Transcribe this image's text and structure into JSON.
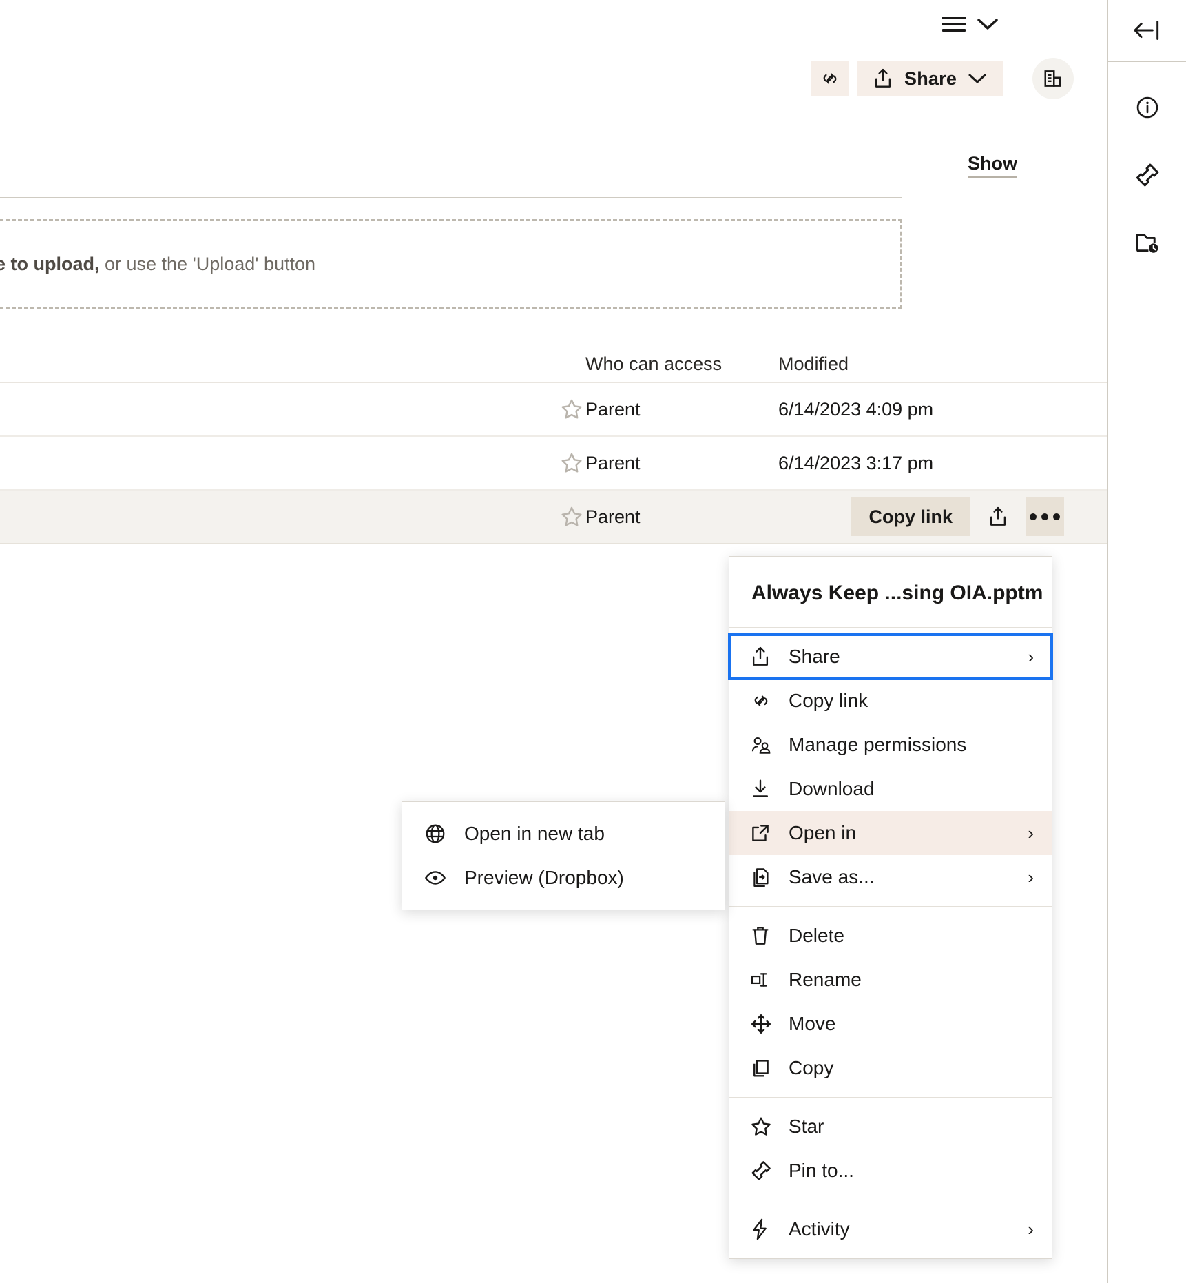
{
  "toolbar": {
    "view_switch_icon": "list-view-icon",
    "view_switch_chevron": "chevron-down-icon",
    "copy_link_icon": "link-icon",
    "share_label": "Share",
    "share_icon": "share-upload-icon",
    "share_chevron": "chevron-down-icon",
    "details_icon": "details-panel-icon"
  },
  "dropzone": {
    "bold_text": "e to upload,",
    "rest_text": " or use the 'Upload' button",
    "show_label": "Show"
  },
  "table": {
    "headers": {
      "name": "",
      "who_can_access": "Who can access",
      "modified": "Modified"
    },
    "rows": [
      {
        "star_icon": "star-outline-icon",
        "who_can_access": "Parent",
        "modified": "6/14/2023 4:09 pm",
        "selected": false
      },
      {
        "star_icon": "star-outline-icon",
        "who_can_access": "Parent",
        "modified": "6/14/2023 3:17 pm",
        "selected": false
      },
      {
        "star_icon": "star-outline-icon",
        "who_can_access": "Parent",
        "modified": "",
        "selected": true
      }
    ],
    "row_actions": {
      "copy_link_label": "Copy link",
      "share_icon": "share-upload-icon",
      "overflow_icon": "more-horizontal-icon"
    }
  },
  "context_menu": {
    "title": "Always Keep ...sing OIA.pptm",
    "groups": [
      {
        "items": [
          {
            "label": "Share",
            "icon": "share-upload-icon",
            "arrow": "›",
            "state": "focused"
          },
          {
            "label": "Copy link",
            "icon": "link-icon",
            "arrow": "",
            "state": ""
          },
          {
            "label": "Manage permissions",
            "icon": "manage-permissions-icon",
            "arrow": "",
            "state": ""
          },
          {
            "label": "Download",
            "icon": "download-icon",
            "arrow": "",
            "state": ""
          },
          {
            "label": "Open in",
            "icon": "open-external-icon",
            "arrow": "›",
            "state": "hover"
          },
          {
            "label": "Save as...",
            "icon": "save-as-icon",
            "arrow": "›",
            "state": ""
          }
        ]
      },
      {
        "items": [
          {
            "label": "Delete",
            "icon": "trash-icon",
            "arrow": "",
            "state": ""
          },
          {
            "label": "Rename",
            "icon": "rename-icon",
            "arrow": "",
            "state": ""
          },
          {
            "label": "Move",
            "icon": "move-icon",
            "arrow": "",
            "state": ""
          },
          {
            "label": "Copy",
            "icon": "copy-icon",
            "arrow": "",
            "state": ""
          }
        ]
      },
      {
        "items": [
          {
            "label": "Star",
            "icon": "star-outline-icon",
            "arrow": "",
            "state": ""
          },
          {
            "label": "Pin to...",
            "icon": "pin-icon",
            "arrow": "",
            "state": ""
          }
        ]
      },
      {
        "items": [
          {
            "label": "Activity",
            "icon": "activity-bolt-icon",
            "arrow": "›",
            "state": ""
          }
        ]
      }
    ]
  },
  "submenu": {
    "items": [
      {
        "label": "Open in new tab",
        "icon": "globe-icon"
      },
      {
        "label": "Preview (Dropbox)",
        "icon": "eye-icon"
      }
    ]
  },
  "right_rail": {
    "collapse_icon": "collapse-panel-icon",
    "buttons": [
      {
        "icon": "info-circle-icon"
      },
      {
        "icon": "pin-icon"
      },
      {
        "icon": "recent-folder-icon"
      }
    ]
  },
  "colors": {
    "accent_focus": "#1a73f0",
    "button_beige": "#f6eee8",
    "hover_beige": "#f6ece6",
    "selected_row": "#f4f2ee",
    "action_beige": "#e8e1d6",
    "border": "#cfcbc2"
  }
}
